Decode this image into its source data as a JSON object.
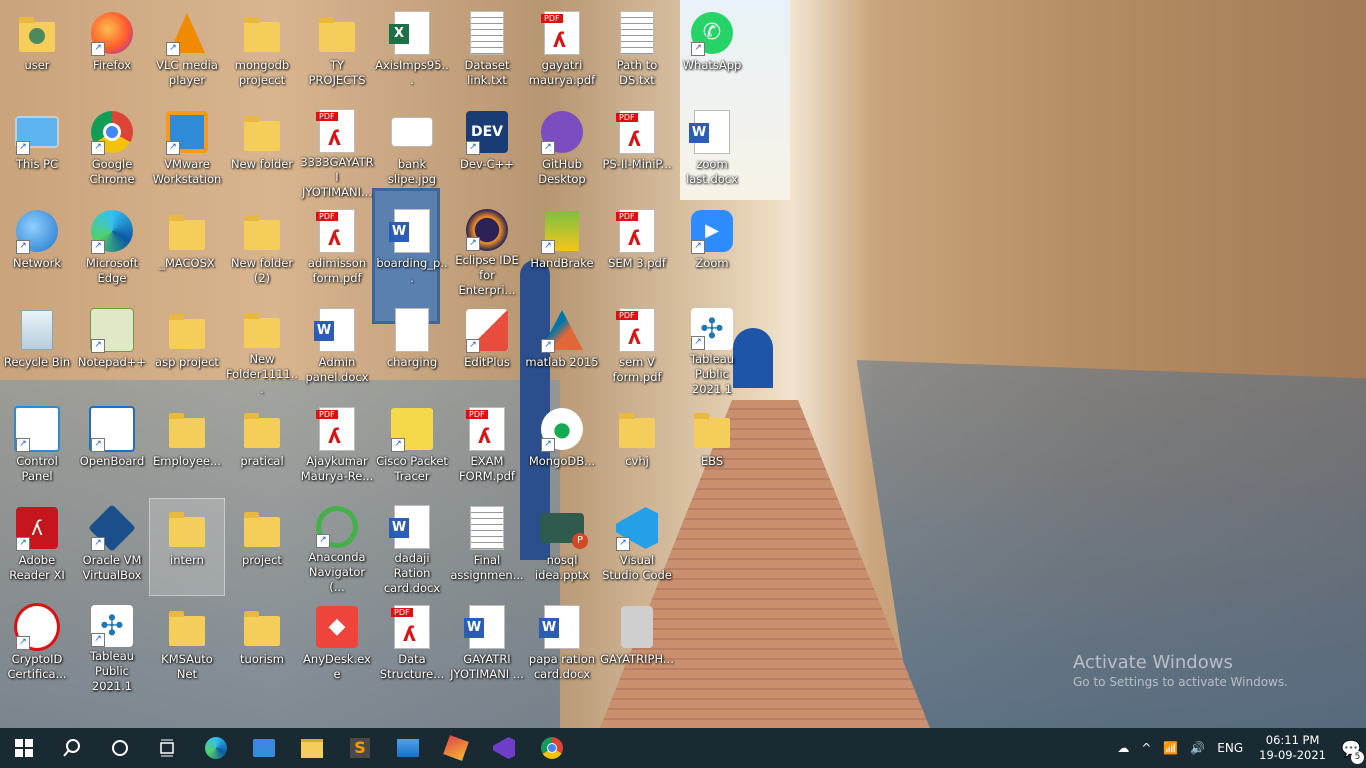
{
  "desktop": {
    "icons": [
      {
        "label": "user",
        "type": "userfolder"
      },
      {
        "label": "Firefox",
        "type": "firefox"
      },
      {
        "label": "VLC media player",
        "type": "vlc"
      },
      {
        "label": "mongodb projecct",
        "type": "folder"
      },
      {
        "label": "TY PROJECTS",
        "type": "folder"
      },
      {
        "label": "AxisImps95...",
        "type": "xls"
      },
      {
        "label": "Dataset link.txt",
        "type": "txt"
      },
      {
        "label": "gayatri maurya.pdf",
        "type": "pdf"
      },
      {
        "label": "Path to DS.txt",
        "type": "txt"
      },
      {
        "label": "WhatsApp",
        "type": "whatsapp"
      },
      {
        "label": "This PC",
        "type": "thispc"
      },
      {
        "label": "Google Chrome",
        "type": "chrome"
      },
      {
        "label": "VMware Workstation",
        "type": "vmware"
      },
      {
        "label": "New folder",
        "type": "folder"
      },
      {
        "label": "3333GAYATRI JYOTIMANI...",
        "type": "pdf"
      },
      {
        "label": "bank slipe.jpg",
        "type": "image"
      },
      {
        "label": "Dev-C++",
        "type": "devcpp"
      },
      {
        "label": "GitHub Desktop",
        "type": "github"
      },
      {
        "label": "PS-II-MiniP...",
        "type": "pdf"
      },
      {
        "label": "zoom last.docx",
        "type": "doc"
      },
      {
        "label": "Network",
        "type": "network"
      },
      {
        "label": "Microsoft Edge",
        "type": "edge"
      },
      {
        "label": "_MACOSX",
        "type": "folder"
      },
      {
        "label": "New folder (2)",
        "type": "folder"
      },
      {
        "label": "adimisson form.pdf",
        "type": "pdf"
      },
      {
        "label": "boarding_p...",
        "type": "doc"
      },
      {
        "label": "Eclipse IDE for Enterpri...",
        "type": "eclipse"
      },
      {
        "label": "HandBrake",
        "type": "handbrake"
      },
      {
        "label": "SEM 3.pdf",
        "type": "pdf"
      },
      {
        "label": "Zoom",
        "type": "zoom"
      },
      {
        "label": "Recycle Bin",
        "type": "recycle"
      },
      {
        "label": "Notepad++",
        "type": "notepadpp"
      },
      {
        "label": "asp project",
        "type": "folder"
      },
      {
        "label": "New Folder1111...",
        "type": "folder"
      },
      {
        "label": "Admin panel.docx",
        "type": "doc"
      },
      {
        "label": "charging",
        "type": "blank"
      },
      {
        "label": "EditPlus",
        "type": "editplus"
      },
      {
        "label": "matlab 2015",
        "type": "matlab"
      },
      {
        "label": "sem V form.pdf",
        "type": "pdf"
      },
      {
        "label": "Tableau Public 2021.1",
        "type": "tableau"
      },
      {
        "label": "Control Panel",
        "type": "control"
      },
      {
        "label": "OpenBoard",
        "type": "openboard"
      },
      {
        "label": "Employee...",
        "type": "folder"
      },
      {
        "label": "pratical",
        "type": "folder"
      },
      {
        "label": "Ajaykumar Maurya-Re...",
        "type": "pdf"
      },
      {
        "label": "Cisco Packet Tracer",
        "type": "cisco"
      },
      {
        "label": "EXAM FORM.pdf",
        "type": "pdf"
      },
      {
        "label": "MongoDB...",
        "type": "mongodb"
      },
      {
        "label": "cvhj",
        "type": "folder"
      },
      {
        "label": "EBS",
        "type": "folder"
      },
      {
        "label": "Adobe Reader XI",
        "type": "adobe"
      },
      {
        "label": "Oracle VM VirtualBox",
        "type": "virtualbox"
      },
      {
        "label": "intern",
        "type": "folder"
      },
      {
        "label": "project",
        "type": "folder"
      },
      {
        "label": "Anaconda Navigator (...",
        "type": "anaconda"
      },
      {
        "label": "dadaji Ration card.docx",
        "type": "doc"
      },
      {
        "label": "Final assignmen...",
        "type": "txt"
      },
      {
        "label": "nosql idea.pptx",
        "type": "pptx"
      },
      {
        "label": "Visual Studio Code",
        "type": "vscode"
      },
      {
        "label": "CryptoID Certifica...",
        "type": "cryptoid"
      },
      {
        "label": "Tableau Public 2021.1",
        "type": "tableau"
      },
      {
        "label": "KMSAuto Net",
        "type": "folder"
      },
      {
        "label": "tuorism",
        "type": "folder"
      },
      {
        "label": "AnyDesk.exe",
        "type": "anydesk"
      },
      {
        "label": "Data Structure...",
        "type": "pdf"
      },
      {
        "label": "GAYATRI JYOTIMANI ...",
        "type": "doc"
      },
      {
        "label": "papa ration card.docx",
        "type": "doc"
      },
      {
        "label": "GAYATRIPH...",
        "type": "photo"
      }
    ],
    "watermark": {
      "title": "Activate Windows",
      "subtitle": "Go to Settings to activate Windows."
    }
  },
  "taskbar": {
    "pinned": [
      "windows-icon",
      "search-icon",
      "cortana-icon",
      "task-view-icon",
      "edge-icon",
      "store-icon",
      "file-explorer-icon",
      "sublime-icon",
      "photos-icon",
      "app-icon",
      "visual-studio-icon",
      "chrome-icon"
    ],
    "tray": {
      "language": "ENG",
      "time": "06:11 PM",
      "date": "19-09-2021",
      "notifications": "5"
    }
  }
}
